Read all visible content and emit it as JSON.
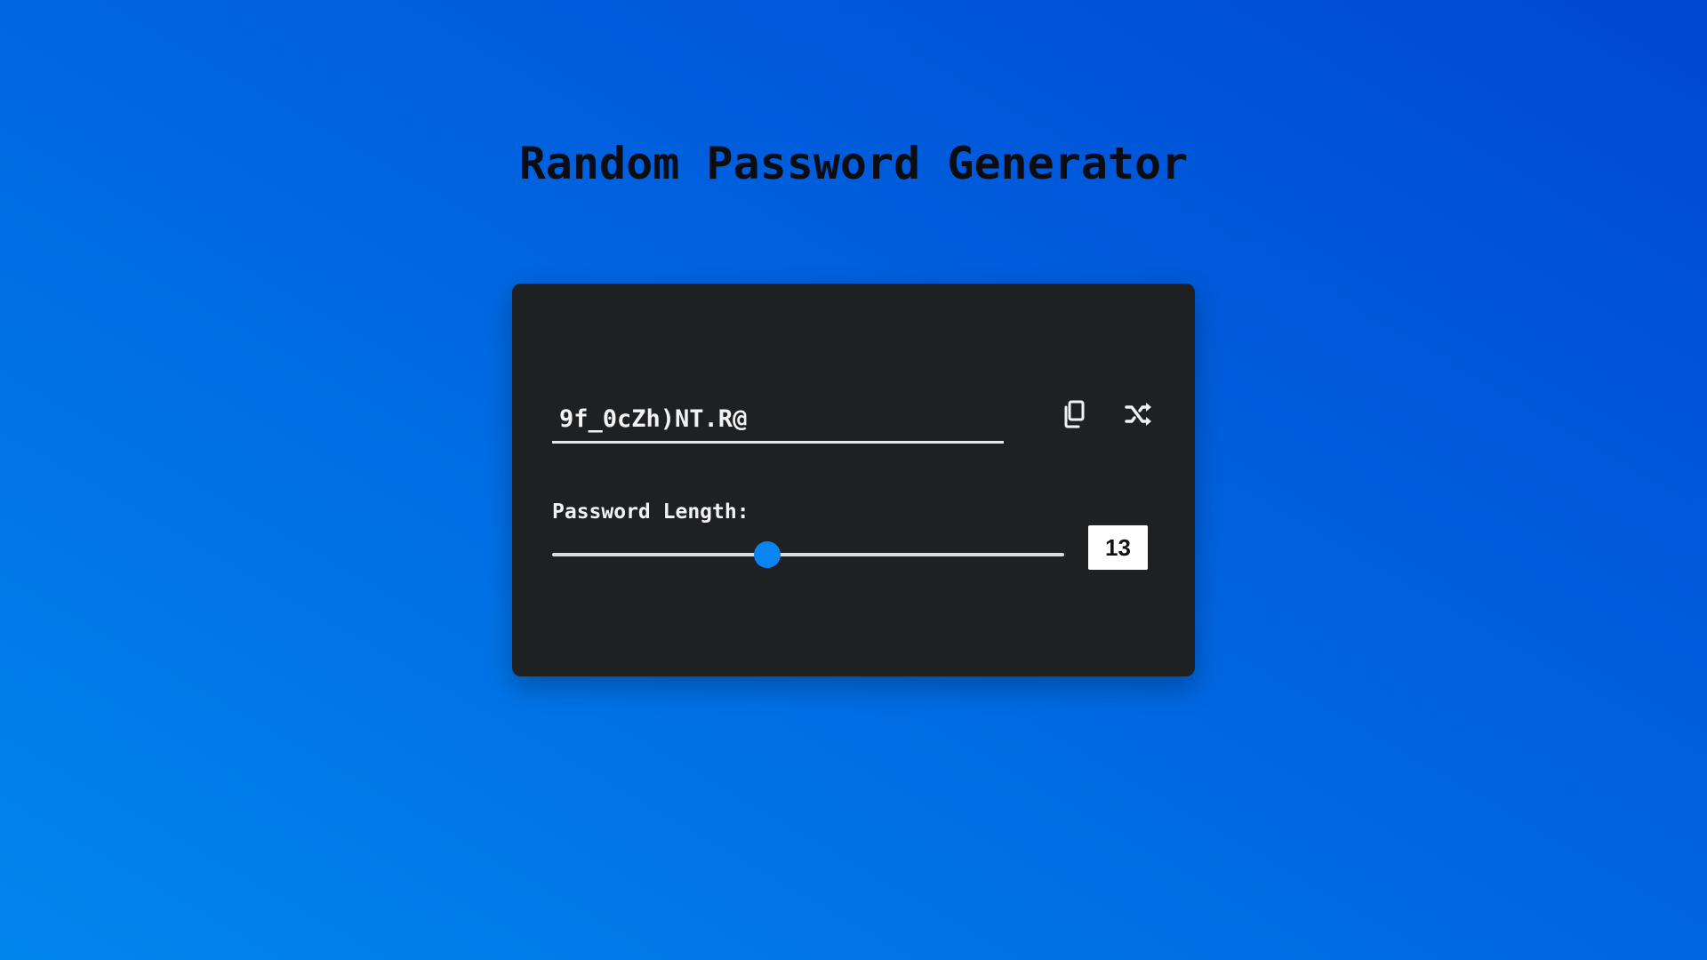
{
  "page": {
    "title": "Random Password Generator"
  },
  "generator": {
    "password_value": "9f_0cZh)NT.R@",
    "copy_icon": "copy-icon",
    "shuffle_icon": "shuffle-icon",
    "length_label": "Password Length:",
    "length_value": "13",
    "slider_fraction": 0.42
  },
  "colors": {
    "background_gradient": [
      "#0186ee",
      "#0048d2"
    ],
    "card": "#1f2022",
    "accent": "#0a84f0",
    "text_light": "#f2f2f2",
    "title_text": "#0b0d12"
  }
}
